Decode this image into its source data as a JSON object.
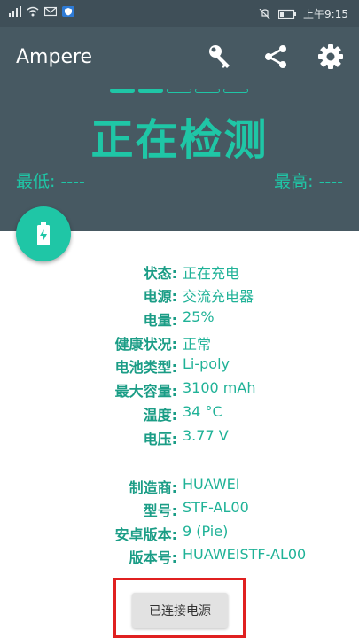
{
  "status_bar": {
    "time": "上午9:15",
    "icons": [
      "signal-icon",
      "wifi-icon",
      "mail-icon",
      "shield-app-icon",
      "mute-icon",
      "battery-icon"
    ]
  },
  "toolbar": {
    "title": "Ampere",
    "actions": [
      "key-icon",
      "share-icon",
      "gear-icon"
    ]
  },
  "colors": {
    "accent": "#1fc6a6",
    "header": "#475962",
    "statusbar": "#3f4f58"
  },
  "monitor": {
    "progress_segments": 5,
    "progress_active": 2,
    "status": "正在检测",
    "min_label": "最低: ----",
    "max_label": "最高: ----"
  },
  "battery_info": [
    {
      "label": "状态:",
      "value": "正在充电"
    },
    {
      "label": "电源:",
      "value": "交流充电器"
    },
    {
      "label": "电量:",
      "value": "25%"
    },
    {
      "label": "健康状况:",
      "value": "正常"
    },
    {
      "label": "电池类型:",
      "value": "Li-poly"
    },
    {
      "label": "最大容量:",
      "value": "3100 mAh"
    },
    {
      "label": "温度:",
      "value": "34 °C"
    },
    {
      "label": "电压:",
      "value": "3.77 V"
    }
  ],
  "device_info": [
    {
      "label": "制造商:",
      "value": "HUAWEI"
    },
    {
      "label": "型号:",
      "value": "STF-AL00"
    },
    {
      "label": "安卓版本:",
      "value": "9 (Pie)"
    },
    {
      "label": "版本号:",
      "value": "HUAWEISTF-AL00"
    }
  ],
  "action_button": {
    "label": "已连接电源"
  }
}
